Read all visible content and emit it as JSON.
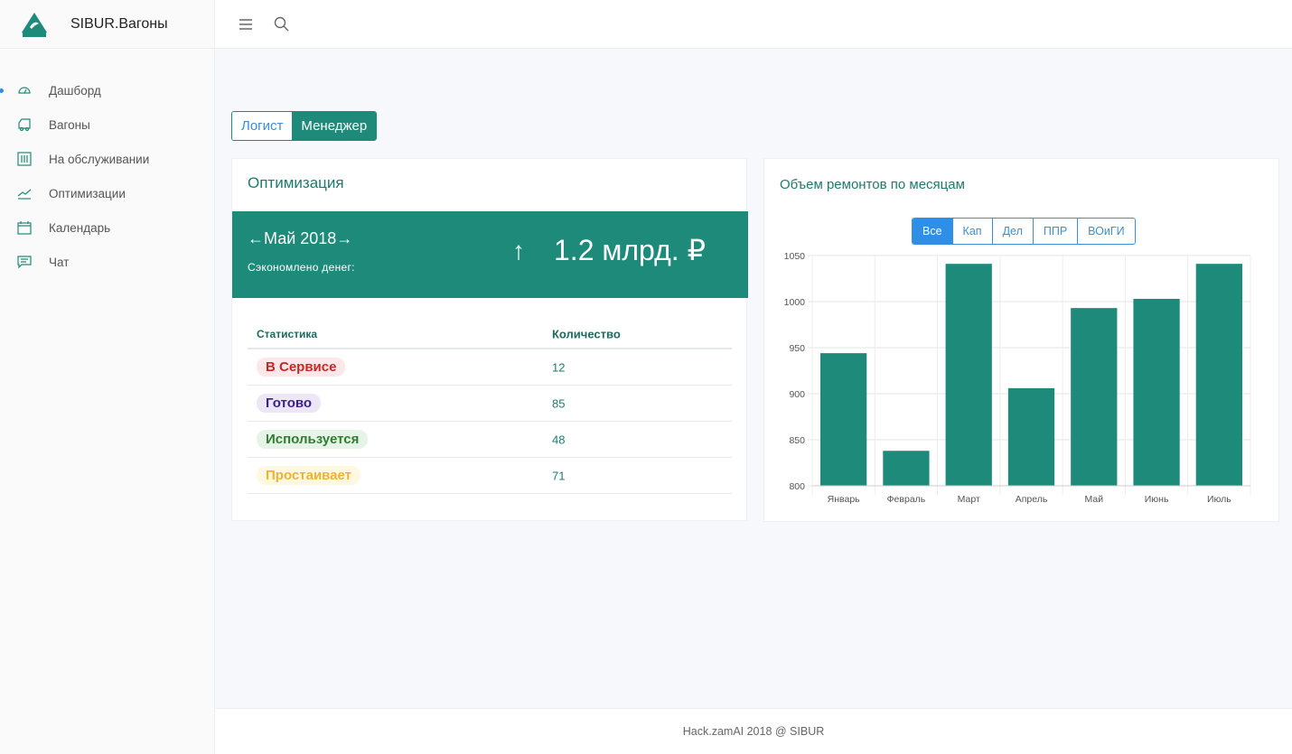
{
  "app": {
    "title": "SIBUR.Вагоны"
  },
  "sidebar": {
    "items": [
      {
        "label": "Дашборд",
        "icon": "dashboard-icon"
      },
      {
        "label": "Вагоны",
        "icon": "truck-icon"
      },
      {
        "label": "На обслуживании",
        "icon": "sliders-icon"
      },
      {
        "label": "Оптимизации",
        "icon": "trend-icon"
      },
      {
        "label": "Календарь",
        "icon": "calendar-icon"
      },
      {
        "label": "Чат",
        "icon": "chat-icon"
      }
    ]
  },
  "roles": {
    "logist": "Логист",
    "manager": "Менеджер"
  },
  "optimization": {
    "title": "Оптимизация",
    "month": "Май 2018",
    "prev": "←",
    "next": "→",
    "saved_label": "Сэкономлено денег:",
    "trend": "↑",
    "amount": "1.2 млрд. ₽",
    "table": {
      "headers": [
        "Статистика",
        "Количество"
      ],
      "rows": [
        {
          "status": "В Сервисе",
          "count": "12",
          "color": "#c62828",
          "bg": "#fde7e9"
        },
        {
          "status": "Готово",
          "count": "85",
          "color": "#3b1f8f",
          "bg": "#ece6f7"
        },
        {
          "status": "Используется",
          "count": "48",
          "color": "#2e7d32",
          "bg": "#e6f4e7"
        },
        {
          "status": "Простаивает",
          "count": "71",
          "color": "#f0b232",
          "bg": "#fff8e1"
        }
      ]
    }
  },
  "repairs": {
    "title": "Объем ремонтов по месяцам",
    "filters": [
      "Все",
      "Кап",
      "Дел",
      "ППР",
      "ВОиГИ"
    ],
    "active_filter": 0
  },
  "chart_data": {
    "type": "bar",
    "categories": [
      "Январь",
      "Февраль",
      "Март",
      "Апрель",
      "Май",
      "Июнь",
      "Июль"
    ],
    "values": [
      944,
      838,
      1041,
      906,
      993,
      1003,
      1041
    ],
    "ylim": [
      800,
      1050
    ],
    "yticks": [
      800,
      850,
      900,
      950,
      1000,
      1050
    ],
    "color": "#1e8a7a",
    "grid": true
  },
  "footer": {
    "text": "Hack.zamAI 2018 @ SIBUR"
  }
}
